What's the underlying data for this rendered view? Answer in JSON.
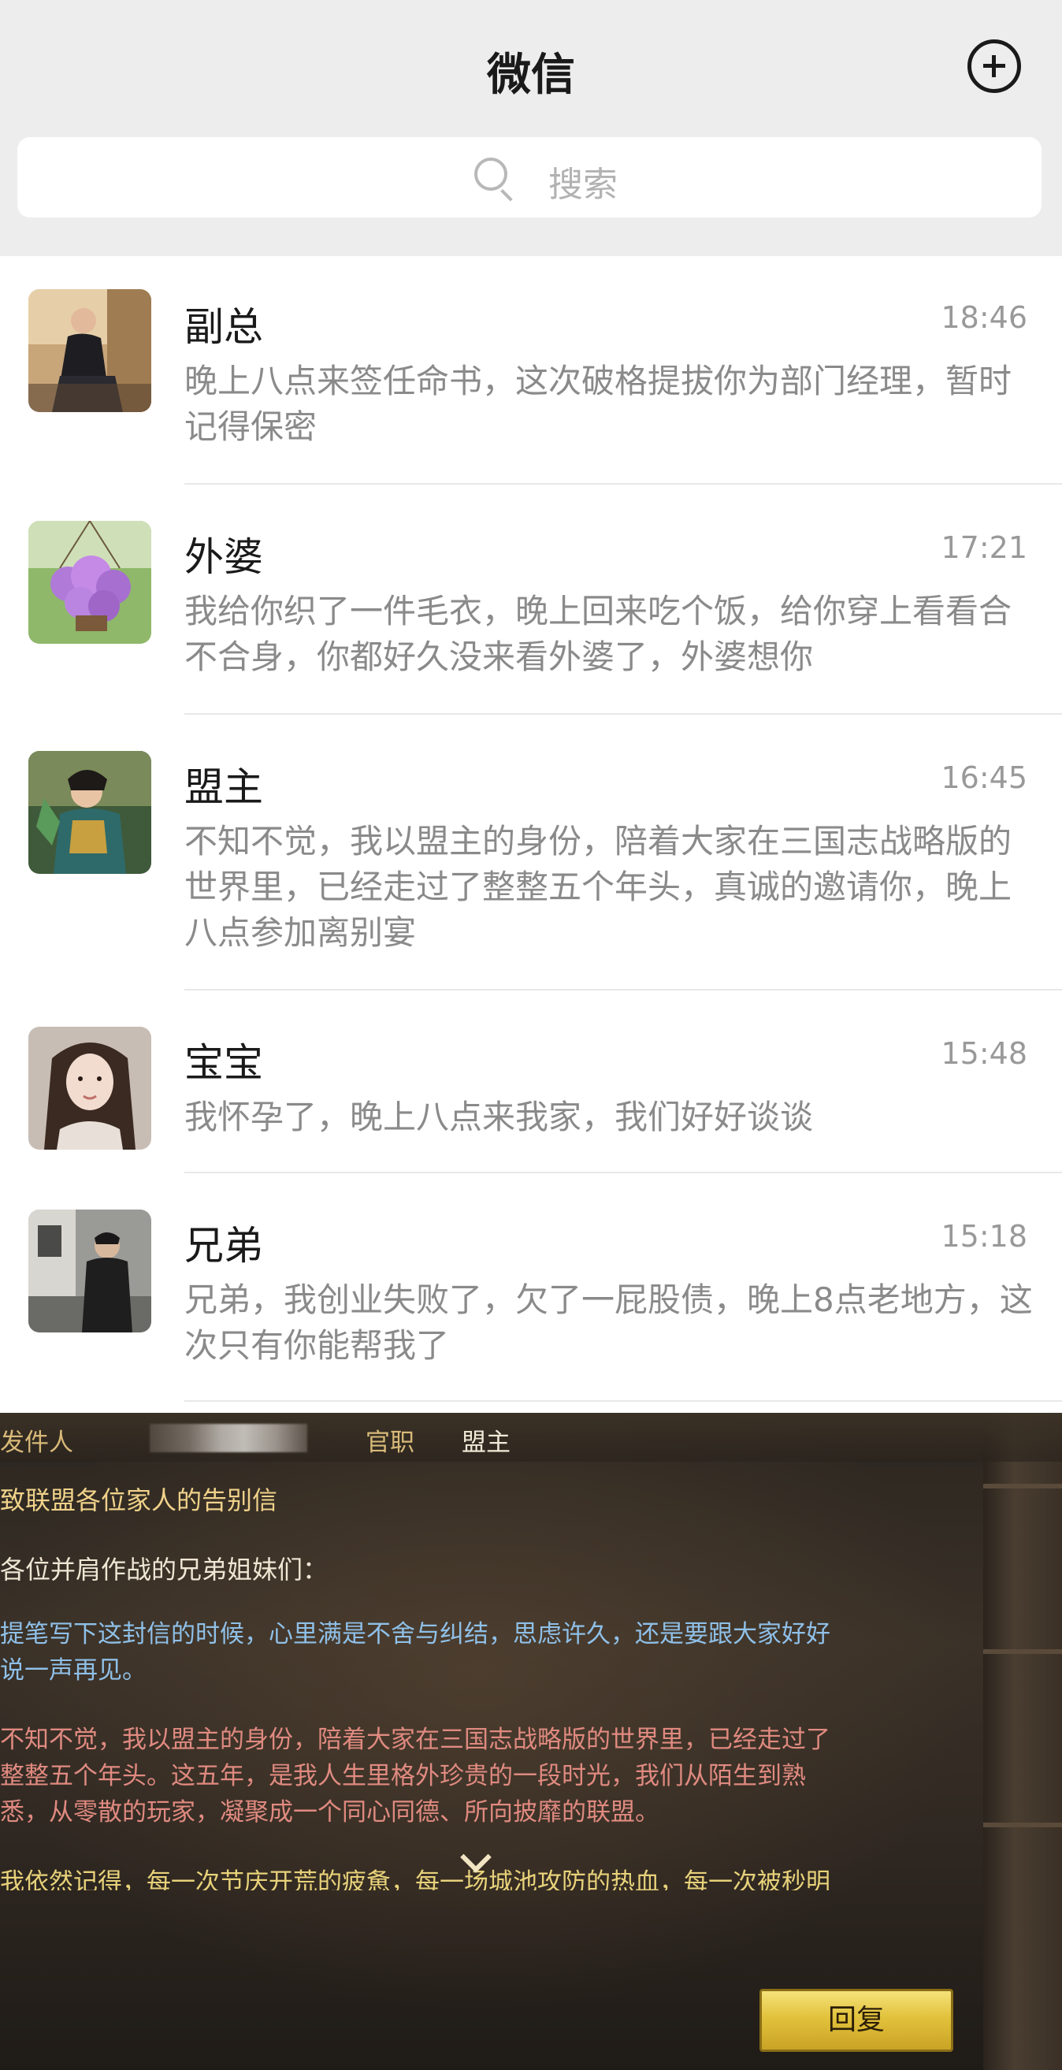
{
  "header": {
    "title": "微信",
    "add_icon": "plus-circle-icon",
    "search_icon": "search-icon",
    "search_placeholder": "搜索"
  },
  "chats": [
    {
      "name": "副总",
      "time": "18:46",
      "message": "晚上八点来签任命书，这次破格提拔你为部门经理，暂时记得保密",
      "avatar": "man-in-suit-photo"
    },
    {
      "name": "外婆",
      "time": "17:21",
      "message": "我给你织了一件毛衣，晚上回来吃个饭，给你穿上看看合不合身，你都好久没来看外婆了，外婆想你",
      "avatar": "purple-flowers-photo"
    },
    {
      "name": "盟主",
      "time": "16:45",
      "message": "不知不觉，我以盟主的身份，陪着大家在三国志战略版的世界里，已经走过了整整五个年头，真诚的邀请你，晚上八点参加离别宴",
      "avatar": "game-character-illustration"
    },
    {
      "name": "宝宝",
      "time": "15:48",
      "message": "我怀孕了，晚上八点来我家，我们好好谈谈",
      "avatar": "long-hair-woman-photo"
    },
    {
      "name": "兄弟",
      "time": "15:18",
      "message": "兄弟，我创业失败了，欠了一屁股债，晚上8点老地方，这次只有你能帮我了",
      "avatar": "man-on-street-photo"
    }
  ],
  "letter": {
    "sender_label": "发件人",
    "position_label": "官职",
    "position_value": "盟主",
    "subject": "致联盟各位家人的告别信",
    "greeting": "各位并肩作战的兄弟姐妹们：",
    "paragraph1": [
      "提笔写下这封信的时候，心里满是不舍与纠结，思虑许久，还是要跟大家好好",
      "说一声再见。"
    ],
    "paragraph2": [
      "不知不觉，我以盟主的身份，陪着大家在三国志战略版的世界里，已经走过了",
      "整整五个年头。这五年，是我人生里格外珍贵的一段时光，我们从陌生到熟",
      "悉，从零散的玩家，凝聚成一个同心同德、所向披靡的联盟。"
    ],
    "paragraph3_clipped": "我依然记得，每一次节庆开荒的疲惫，每一场城池攻防的热血，每一次被秒明",
    "expand_icon": "chevron-down-icon",
    "reply_button": "回复"
  },
  "colors": {
    "header_bg": "#ededed",
    "name_text": "#1a1a1a",
    "message_text": "#8a8a8a",
    "time_text": "#999999",
    "letter_gold": "#d8b978",
    "letter_blue": "#8fc0e8",
    "letter_red": "#e08a80",
    "reply_button_gold": "#e2c23c"
  }
}
